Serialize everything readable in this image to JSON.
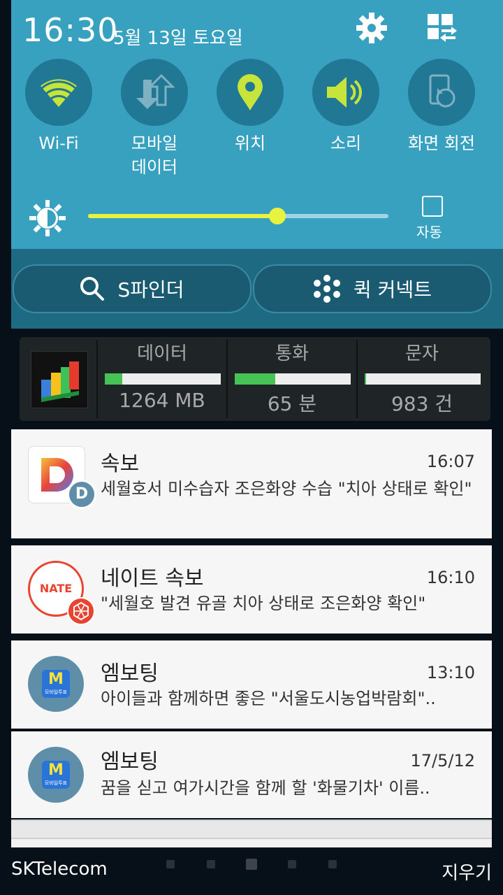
{
  "status": {
    "time": "16:30",
    "date": "5월 13일 토요일"
  },
  "toggles": [
    {
      "label": "Wi-Fi",
      "icon": "wifi-icon"
    },
    {
      "label": "모바일\n데이터",
      "icon": "mobile-data-icon"
    },
    {
      "label": "위치",
      "icon": "location-icon"
    },
    {
      "label": "소리",
      "icon": "sound-icon"
    },
    {
      "label": "화면 회전",
      "icon": "rotate-icon"
    }
  ],
  "brightness": {
    "level": 0.63,
    "auto_label": "자동"
  },
  "actions": {
    "sfinder": "S파인더",
    "quick_connect": "퀵 커넥트"
  },
  "usage": {
    "data": {
      "label": "데이터",
      "value": "1264 MB",
      "fraction": 0.15
    },
    "call": {
      "label": "통화",
      "value": "65 분",
      "fraction": 0.35
    },
    "sms": {
      "label": "문자",
      "value": "983 건",
      "fraction": 0.01
    }
  },
  "notifications": [
    {
      "title": "속보",
      "time": "16:07",
      "body": "세월호서 미수습자 조은화양 수습 \"치아 상태로 확인\""
    },
    {
      "title": "네이트 속보",
      "time": "16:10",
      "body": "\"세월호 발견 유골 치아 상태로 조은화양 확인\""
    },
    {
      "title": "엠보팅",
      "time": "13:10",
      "body": "아이들과 함께하면 좋은 \"서울도시농업박람회\".."
    },
    {
      "title": "엠보팅",
      "time": "17/5/12",
      "body": "꿈을 싣고 여가시간을 함께 할 '화물기차' 이름.."
    }
  ],
  "icons": {
    "nate_text": "NATE",
    "d_letter": "D",
    "m_letter": "M",
    "m_sub": "모바일투표"
  },
  "footer": {
    "carrier": "SKTelecom",
    "clear": "지우기"
  },
  "colors": {
    "panel": "#37a1bf",
    "toggle_active": "#c6e43a",
    "toggle_bg": "#217894",
    "slider": "#e9f23c",
    "usage_fill": "#46c354"
  }
}
